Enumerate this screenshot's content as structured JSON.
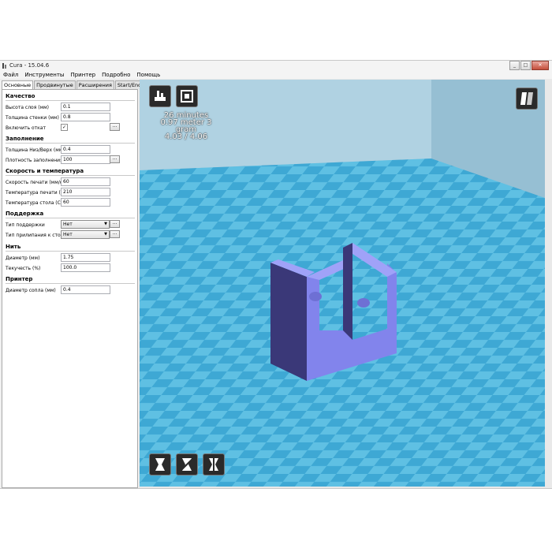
{
  "window": {
    "title": "Cura - 15.04.6",
    "minimize_label": "_",
    "maximize_label": "□",
    "close_label": "✕"
  },
  "menu": [
    "Файл",
    "Инструменты",
    "Принтер",
    "Подробно",
    "Помощь"
  ],
  "tabs": [
    "Основные",
    "Продвинутые",
    "Расширения",
    "Start/End-GCode"
  ],
  "sections": {
    "quality": {
      "title": "Качество",
      "layer_height_label": "Высота слоя (мм)",
      "layer_height_value": "0.1",
      "wall_thickness_label": "Толщина стенки (мм)",
      "wall_thickness_value": "0.8",
      "retraction_label": "Включить откат",
      "retraction_checked": "✓"
    },
    "fill": {
      "title": "Заполнение",
      "bottom_top_label": "Толщина Низ/Верх (мм)",
      "bottom_top_value": "0.4",
      "density_label": "Плотность заполнения",
      "density_value": "100"
    },
    "speed": {
      "title": "Скорость и температура",
      "print_speed_label": "Скорость печати (мм/с)",
      "print_speed_value": "60",
      "print_temp_label": "Температура печати (С)",
      "print_temp_value": "210",
      "bed_temp_label": "Температура стола (С)",
      "bed_temp_value": "60"
    },
    "support": {
      "title": "Поддержка",
      "support_type_label": "Тип поддержки",
      "support_type_value": "Нет",
      "adhesion_label": "Тип прилипания к столу",
      "adhesion_value": "Нет"
    },
    "filament": {
      "title": "Нить",
      "diameter_label": "Диаметр (мм)",
      "diameter_value": "1.75",
      "flow_label": "Текучесть (%)",
      "flow_value": "100.0"
    },
    "machine": {
      "title": "Принтер",
      "nozzle_label": "Диаметр сопла (мм)",
      "nozzle_value": "0.4"
    },
    "more_button": "..."
  },
  "viewport": {
    "stats_line1": "26 minutes",
    "stats_line2": "0.97 meter 3 gram",
    "stats_line3": "4.03 / 4.06",
    "icons": {
      "load": "load-model-icon",
      "save_toolpath": "save-toolpath-icon",
      "view_mode": "view-mode-icon",
      "rotate": "rotate-icon",
      "scale": "scale-icon",
      "mirror": "mirror-icon"
    },
    "colors": {
      "floor_light": "#5fc0e3",
      "floor_dark": "#3ea8d4",
      "wall": "#9fc3d5",
      "model_front": "#8284ec",
      "model_side": "#3a3878",
      "model_top": "#a0a2f8"
    }
  }
}
